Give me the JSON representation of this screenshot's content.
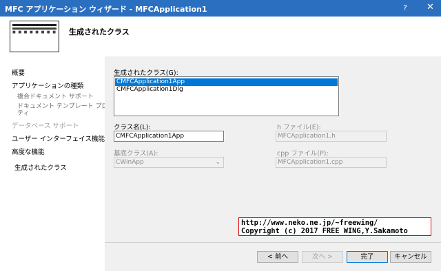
{
  "window": {
    "title": "MFC アプリケーション ウィザード - MFCApplication1",
    "help_glyph": "?",
    "close_glyph": "✕"
  },
  "header": {
    "title": "生成されたクラス",
    "icon": "wizard-window-icon"
  },
  "nav": {
    "items": [
      {
        "label": "概要"
      },
      {
        "label": "アプリケーションの種類"
      },
      {
        "label": "複合ドキュメント サポート"
      },
      {
        "label": "ドキュメント テンプレート プロパ"
      },
      {
        "label": "ティ"
      },
      {
        "label": "データベース サポート"
      },
      {
        "label": "ユーザー インターフェイス機能"
      },
      {
        "label": "高度な機能"
      },
      {
        "label": "生成されたクラス"
      }
    ]
  },
  "main": {
    "classes_label": "生成されたクラス(G):",
    "classes": [
      "CMFCApplication1App",
      "CMFCApplication1Dlg"
    ],
    "selected_class": "CMFCApplication1App",
    "class_name_label": "クラス名(L):",
    "class_name_value": "CMFCApplication1App",
    "h_file_label": "h ファイル(E):",
    "h_file_value": "MFCApplication1.h",
    "base_class_label": "基底クラス(A):",
    "base_class_value": "CWinApp",
    "cpp_file_label": "cpp ファイル(P):",
    "cpp_file_value": "MFCApplication1.cpp"
  },
  "watermark": {
    "line1": "http://www.neko.ne.jp/~freewing/",
    "line2": "Copyright (c) 2017 FREE WING,Y.Sakamoto"
  },
  "buttons": {
    "prev": "< 前へ",
    "next": "次へ >",
    "finish": "完了",
    "cancel": "キャンセル"
  },
  "colors": {
    "titlebar": "#2b6fc1",
    "selection": "#0078d7",
    "watermark_border": "#e00000"
  }
}
